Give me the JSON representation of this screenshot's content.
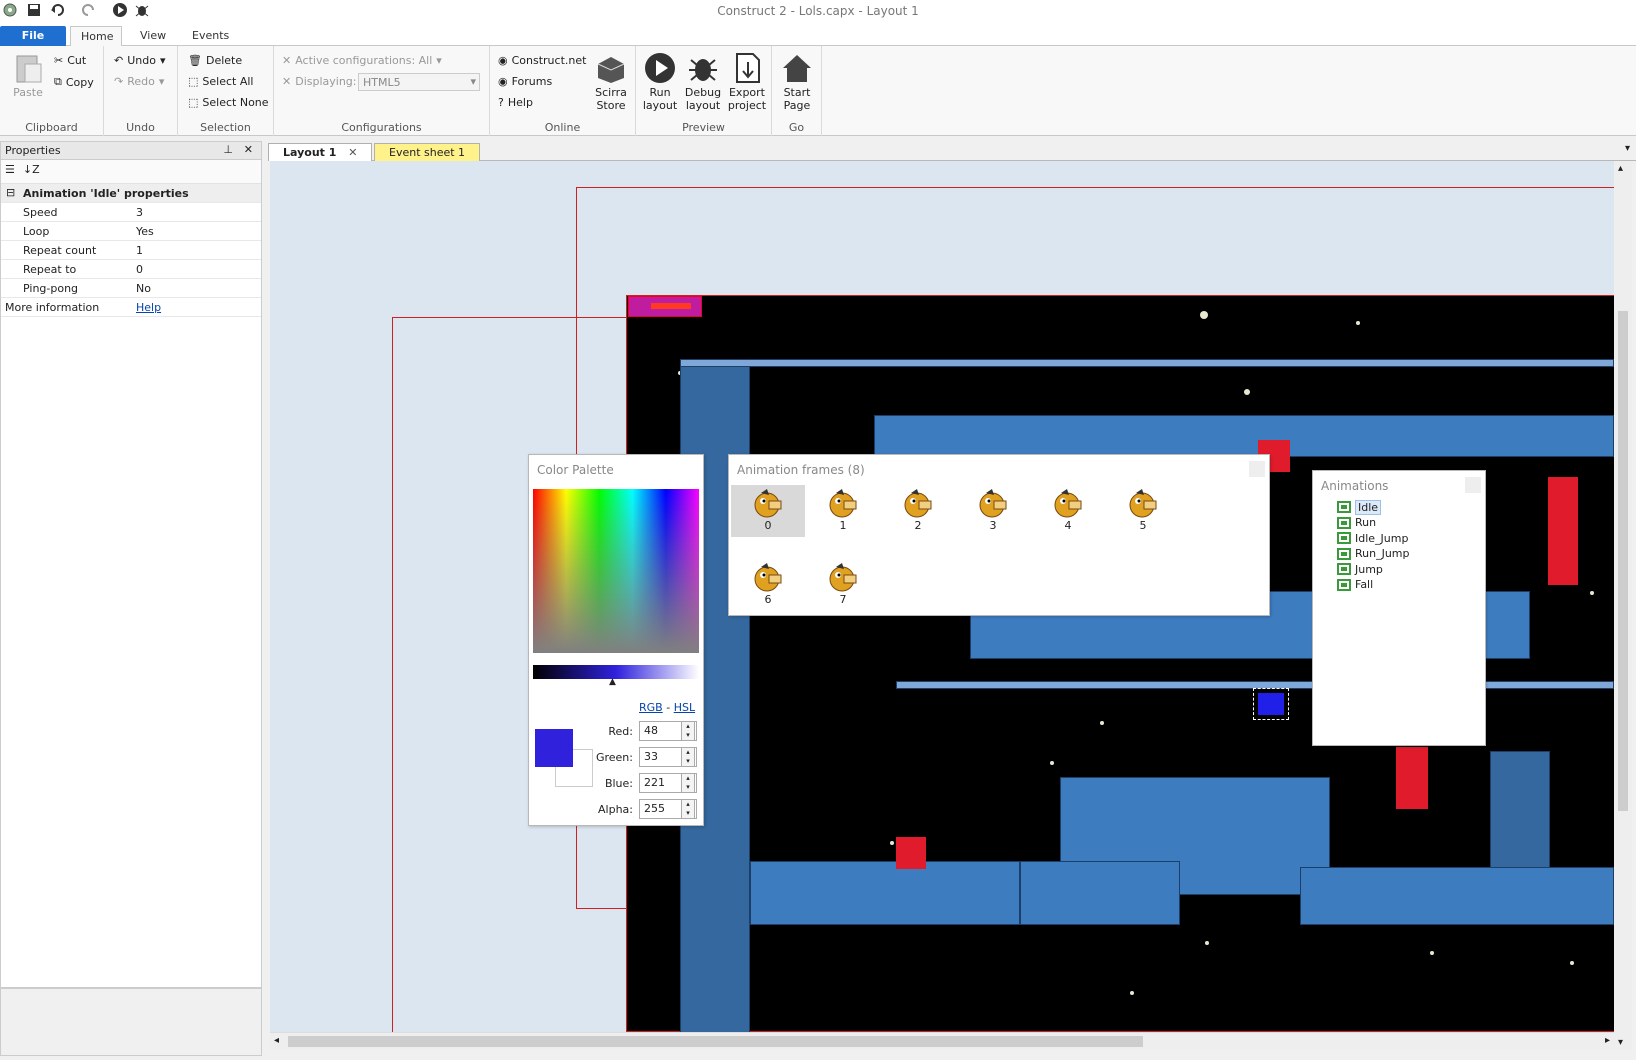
{
  "window": {
    "title": "Construct 2 - Lols.capx - Layout 1"
  },
  "ribbon_tabs": [
    "File",
    "Home",
    "View",
    "Events"
  ],
  "ribbon": {
    "clipboard": {
      "paste": "Paste",
      "cut": "Cut",
      "copy": "Copy",
      "label": "Clipboard"
    },
    "undo": {
      "undo": "Undo",
      "redo": "Redo",
      "label": "Undo"
    },
    "selection": {
      "delete": "Delete",
      "select_all": "Select All",
      "select_none": "Select None",
      "label": "Selection"
    },
    "configurations": {
      "active": "Active configurations: All",
      "displaying_label": "Displaying:",
      "displaying_value": "HTML5",
      "label": "Configurations"
    },
    "online": {
      "construct_net": "Construct.net",
      "forums": "Forums",
      "help": "Help",
      "scirra_store_1": "Scirra",
      "scirra_store_2": "Store",
      "label": "Online"
    },
    "preview": {
      "run_1": "Run",
      "run_2": "layout",
      "debug_1": "Debug",
      "debug_2": "layout",
      "export_1": "Export",
      "export_2": "project",
      "label": "Preview"
    },
    "go": {
      "start_1": "Start",
      "start_2": "Page",
      "label": "Go"
    }
  },
  "properties": {
    "title": "Properties",
    "category": "Animation 'Idle' properties",
    "rows": [
      {
        "key": "Speed",
        "value": "3"
      },
      {
        "key": "Loop",
        "value": "Yes"
      },
      {
        "key": "Repeat count",
        "value": "1"
      },
      {
        "key": "Repeat to",
        "value": "0"
      },
      {
        "key": "Ping-pong",
        "value": "No"
      }
    ],
    "more_info_label": "More information",
    "more_info_link": "Help"
  },
  "doc_tabs": {
    "layout": "Layout 1",
    "events": "Event sheet 1"
  },
  "color_palette": {
    "title": "Color Palette",
    "rgb_link": "RGB",
    "sep": "-",
    "hsl_link": "HSL",
    "red_label": "Red:",
    "red": "48",
    "green_label": "Green:",
    "green": "33",
    "blue_label": "Blue:",
    "blue": "221",
    "alpha_label": "Alpha:",
    "alpha": "255",
    "swatch_color": "#3021dd"
  },
  "animation_frames": {
    "title": "Animation frames (8)",
    "frames": [
      "0",
      "1",
      "2",
      "3",
      "4",
      "5",
      "6",
      "7"
    ]
  },
  "animations": {
    "title": "Animations",
    "items": [
      "Idle",
      "Run",
      "Idle_Jump",
      "Run_Jump",
      "Jump",
      "Fall"
    ]
  },
  "colors": {
    "accent": "#1e6fd0",
    "block": "#3e7cc0",
    "red": "#e01c2c",
    "bg": "#dce6f1"
  }
}
